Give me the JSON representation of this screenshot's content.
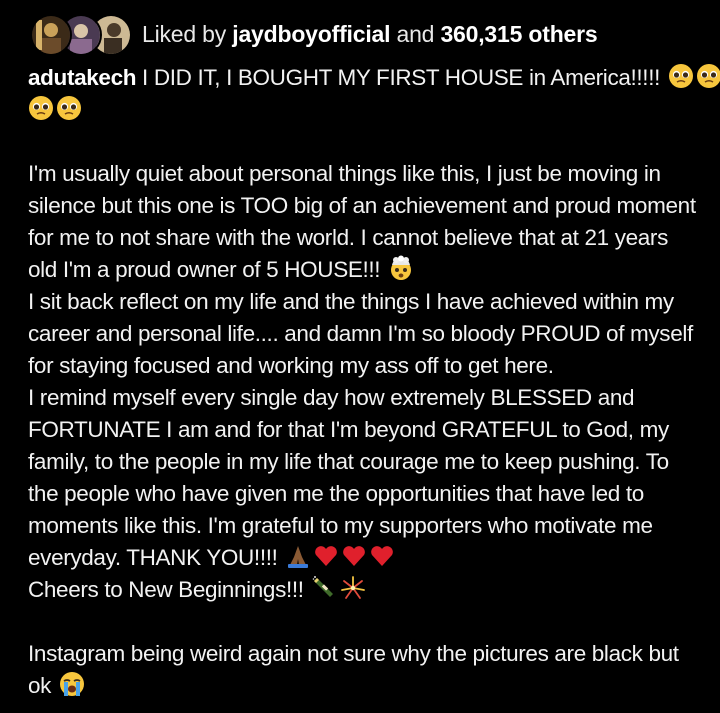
{
  "likes": {
    "prefix": "Liked by ",
    "user": "jaydboyofficial",
    "middle": " and ",
    "count": "360,315 others"
  },
  "avatars": [
    {
      "name": "avatar-1",
      "colors": [
        "#c9a15a",
        "#6b4b2a"
      ]
    },
    {
      "name": "avatar-2",
      "colors": [
        "#8b6a8f",
        "#d9c5a8"
      ]
    },
    {
      "name": "avatar-3",
      "colors": [
        "#b9a27a",
        "#4a3a2a"
      ]
    }
  ],
  "caption": {
    "username": "adutakech",
    "first_line": " I DID IT, I BOUGHT MY FIRST HOUSE in America!!!!! ",
    "p1": [
      "I'm usually quiet about personal things like this, I just be moving in",
      "silence but this one is TOO big of an achievement and proud moment",
      "for me to not share with the world. I cannot believe that at 21 years",
      "old I'm a proud owner of 5 HOUSE!!! "
    ],
    "p2": [
      "I sit back reflect on my life and the things I have achieved within my",
      "career and personal life.... and damn I'm so bloody PROUD of myself",
      "for staying focused and working my ass off to get here."
    ],
    "p3": [
      "I remind myself every single day how extremely BLESSED and",
      "FORTUNATE I am and for that I'm beyond GRATEFUL to God, my",
      "family, to the people in my life that courage me to keep pushing. To",
      "the people who have given me the opportunities that have led to",
      "moments like this. I'm grateful to my supporters who motivate me",
      "everyday. THANK YOU!!!! "
    ],
    "p4": "Cheers to New Beginnings!!! ",
    "p5": [
      "Instagram being weird again not sure why the pictures are black but",
      "ok "
    ]
  },
  "emoji_names": {
    "pleading": "pleading-face-icon",
    "exploding": "exploding-head-icon",
    "praying": "folded-hands-icon",
    "heart": "red-heart-icon",
    "bottle": "champagne-bottle-icon",
    "fireworks": "fireworks-icon",
    "crying": "loudly-crying-face-icon"
  }
}
